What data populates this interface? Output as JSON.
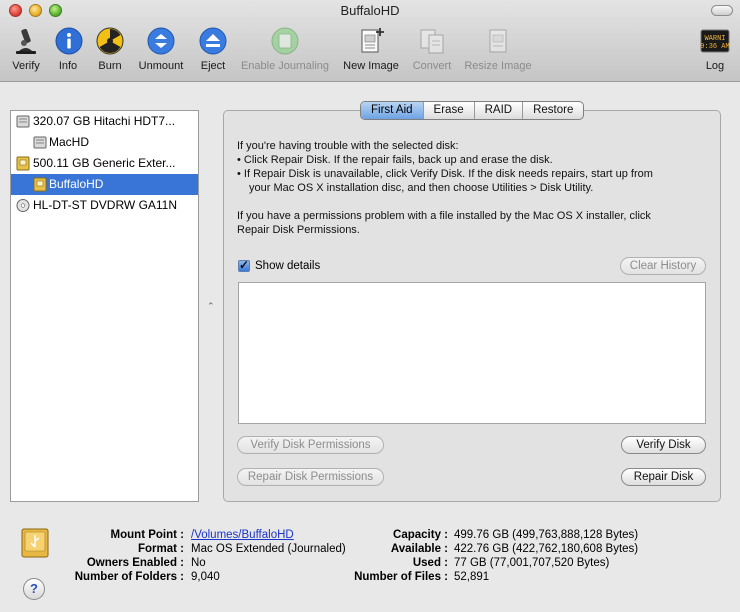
{
  "window": {
    "title": "BuffaloHD"
  },
  "toolbar": {
    "verify": "Verify",
    "info": "Info",
    "burn": "Burn",
    "unmount": "Unmount",
    "eject": "Eject",
    "enable_journaling": "Enable Journaling",
    "new_image": "New Image",
    "convert": "Convert",
    "resize_image": "Resize Image",
    "log": "Log",
    "log_icon_text": "WARNI\n9:36 AM"
  },
  "sidebar": {
    "items": [
      {
        "label": "320.07 GB Hitachi HDT7..."
      },
      {
        "label": "MacHD"
      },
      {
        "label": "500.11 GB Generic Exter..."
      },
      {
        "label": "BuffaloHD"
      },
      {
        "label": "HL-DT-ST DVDRW GA11N"
      }
    ]
  },
  "tabs": [
    "First Aid",
    "Erase",
    "RAID",
    "Restore"
  ],
  "first_aid": {
    "line1": "If you're having trouble with the selected disk:",
    "line2": "• Click Repair Disk. If the repair fails, back up and erase the disk.",
    "line3": "• If Repair Disk is unavailable, click Verify Disk. If the disk needs repairs, start up from",
    "line4": "your Mac OS X installation disc, and then choose Utilities > Disk Utility.",
    "line5": "If you have a permissions problem with a file installed by the Mac OS X installer, click",
    "line6": "Repair Disk Permissions.",
    "show_details": "Show details",
    "clear_history": "Clear History",
    "verify_permissions": "Verify Disk Permissions",
    "repair_permissions": "Repair Disk Permissions",
    "verify_disk": "Verify Disk",
    "repair_disk": "Repair Disk"
  },
  "details": {
    "mount_point_label": "Mount Point :",
    "mount_point_value": "/Volumes/BuffaloHD",
    "format_label": "Format :",
    "format_value": "Mac OS Extended (Journaled)",
    "owners_label": "Owners Enabled :",
    "owners_value": "No",
    "folders_label": "Number of Folders :",
    "folders_value": "9,040",
    "capacity_label": "Capacity :",
    "capacity_value": "499.76 GB (499,763,888,128 Bytes)",
    "available_label": "Available :",
    "available_value": "422.76 GB (422,762,180,608 Bytes)",
    "used_label": "Used :",
    "used_value": "77 GB (77,001,707,520 Bytes)",
    "files_label": "Number of Files :",
    "files_value": "52,891",
    "help": "?"
  }
}
